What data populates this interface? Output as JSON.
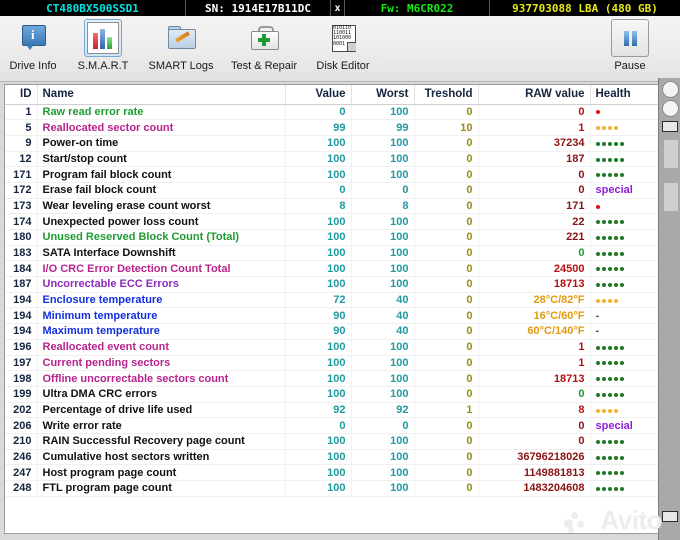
{
  "window": {
    "drive_model": "CT480BX500SSD1",
    "serial": "SN: 1914E17B11DC",
    "close_label": "x",
    "firmware": "Fw: M6CR022",
    "capacity": "937703088 LBA (480 GB)",
    "colors": {
      "model": "#00e5e5",
      "serial": "#ffffff",
      "firmware": "#14e814",
      "capacity": "#e8e814",
      "topbar_bg": "#000000"
    }
  },
  "toolbar": {
    "items": [
      {
        "label": "Drive Info",
        "icon": "info-bubble-icon",
        "selected": false
      },
      {
        "label": "S.M.A.R.T",
        "icon": "bar-chart-icon",
        "selected": true
      },
      {
        "label": "SMART Logs",
        "icon": "folder-pencil-icon",
        "selected": false
      },
      {
        "label": "Test & Repair",
        "icon": "first-aid-kit-icon",
        "selected": false
      },
      {
        "label": "Disk Editor",
        "icon": "hex-page-icon",
        "selected": false
      }
    ],
    "pause": {
      "label": "Pause",
      "icon": "pause-icon"
    },
    "hex_icon_text": [
      "010110",
      "110011",
      "101000",
      "0001"
    ]
  },
  "table": {
    "columns": [
      {
        "key": "id",
        "label": "ID"
      },
      {
        "key": "name",
        "label": "Name"
      },
      {
        "key": "value",
        "label": "Value"
      },
      {
        "key": "worst",
        "label": "Worst"
      },
      {
        "key": "thr",
        "label": "Treshold"
      },
      {
        "key": "raw",
        "label": "RAW value"
      },
      {
        "key": "health",
        "label": "Health"
      }
    ],
    "rows": [
      {
        "id": "1",
        "name": "Raw read error rate",
        "name_color": "green",
        "value": "0",
        "worst": "100",
        "thr": "0",
        "raw": "0",
        "raw_color": "red",
        "health": "dots",
        "dots": 1,
        "dot_color": "r"
      },
      {
        "id": "5",
        "name": "Reallocated sector count",
        "name_color": "magenta",
        "value": "99",
        "worst": "99",
        "thr": "10",
        "raw": "1",
        "raw_color": "red",
        "health": "dots",
        "dots": 4,
        "dot_color": "o"
      },
      {
        "id": "9",
        "name": "Power-on time",
        "name_color": "black",
        "value": "100",
        "worst": "100",
        "thr": "0",
        "raw": "37234",
        "raw_color": "dark",
        "health": "dots",
        "dots": 5,
        "dot_color": "g"
      },
      {
        "id": "12",
        "name": "Start/stop count",
        "name_color": "black",
        "value": "100",
        "worst": "100",
        "thr": "0",
        "raw": "187",
        "raw_color": "dark",
        "health": "dots",
        "dots": 5,
        "dot_color": "g"
      },
      {
        "id": "171",
        "name": "Program fail block count",
        "name_color": "black",
        "value": "100",
        "worst": "100",
        "thr": "0",
        "raw": "0",
        "raw_color": "dark",
        "health": "dots",
        "dots": 5,
        "dot_color": "g"
      },
      {
        "id": "172",
        "name": "Erase fail block count",
        "name_color": "black",
        "value": "0",
        "worst": "0",
        "thr": "0",
        "raw": "0",
        "raw_color": "dark",
        "health": "special"
      },
      {
        "id": "173",
        "name": "Wear leveling erase count worst",
        "name_color": "black",
        "value": "8",
        "worst": "8",
        "thr": "0",
        "raw": "171",
        "raw_color": "dark",
        "health": "dots",
        "dots": 1,
        "dot_color": "r"
      },
      {
        "id": "174",
        "name": "Unexpected power loss count",
        "name_color": "black",
        "value": "100",
        "worst": "100",
        "thr": "0",
        "raw": "22",
        "raw_color": "dark",
        "health": "dots",
        "dots": 5,
        "dot_color": "g"
      },
      {
        "id": "180",
        "name": "Unused Reserved Block Count (Total)",
        "name_color": "green",
        "value": "100",
        "worst": "100",
        "thr": "0",
        "raw": "221",
        "raw_color": "dark",
        "health": "dots",
        "dots": 5,
        "dot_color": "g"
      },
      {
        "id": "183",
        "name": "SATA Interface Downshift",
        "name_color": "black",
        "value": "100",
        "worst": "100",
        "thr": "0",
        "raw": "0",
        "raw_color": "green",
        "health": "dots",
        "dots": 5,
        "dot_color": "g"
      },
      {
        "id": "184",
        "name": "I/O CRC Error Detection Count Total",
        "name_color": "magenta",
        "value": "100",
        "worst": "100",
        "thr": "0",
        "raw": "24500",
        "raw_color": "red",
        "health": "dots",
        "dots": 5,
        "dot_color": "g"
      },
      {
        "id": "187",
        "name": "Uncorrectable ECC Errors",
        "name_color": "purple",
        "value": "100",
        "worst": "100",
        "thr": "0",
        "raw": "18713",
        "raw_color": "red",
        "health": "dots",
        "dots": 5,
        "dot_color": "g"
      },
      {
        "id": "194",
        "name": "Enclosure temperature",
        "name_color": "blue",
        "value": "72",
        "worst": "40",
        "thr": "0",
        "raw": "28°C/82°F",
        "raw_color": "orange",
        "health": "dots",
        "dots": 4,
        "dot_color": "o"
      },
      {
        "id": "194",
        "name": "Minimum temperature",
        "name_color": "blue",
        "value": "90",
        "worst": "40",
        "thr": "0",
        "raw": "16°C/60°F",
        "raw_color": "orange",
        "health": "dash"
      },
      {
        "id": "194",
        "name": "Maximum temperature",
        "name_color": "blue",
        "value": "90",
        "worst": "40",
        "thr": "0",
        "raw": "60°C/140°F",
        "raw_color": "orange",
        "health": "dash"
      },
      {
        "id": "196",
        "name": "Reallocated event count",
        "name_color": "magenta",
        "value": "100",
        "worst": "100",
        "thr": "0",
        "raw": "1",
        "raw_color": "red",
        "health": "dots",
        "dots": 5,
        "dot_color": "g"
      },
      {
        "id": "197",
        "name": "Current pending sectors",
        "name_color": "magenta",
        "value": "100",
        "worst": "100",
        "thr": "0",
        "raw": "1",
        "raw_color": "red",
        "health": "dots",
        "dots": 5,
        "dot_color": "g"
      },
      {
        "id": "198",
        "name": "Offline uncorrectable sectors count",
        "name_color": "magenta",
        "value": "100",
        "worst": "100",
        "thr": "0",
        "raw": "18713",
        "raw_color": "red",
        "health": "dots",
        "dots": 5,
        "dot_color": "g"
      },
      {
        "id": "199",
        "name": "Ultra DMA CRC errors",
        "name_color": "black",
        "value": "100",
        "worst": "100",
        "thr": "0",
        "raw": "0",
        "raw_color": "green",
        "health": "dots",
        "dots": 5,
        "dot_color": "g"
      },
      {
        "id": "202",
        "name": "Percentage of drive life used",
        "name_color": "black",
        "value": "92",
        "worst": "92",
        "thr": "1",
        "raw": "8",
        "raw_color": "red",
        "health": "dots",
        "dots": 4,
        "dot_color": "o"
      },
      {
        "id": "206",
        "name": "Write error rate",
        "name_color": "black",
        "value": "0",
        "worst": "0",
        "thr": "0",
        "raw": "0",
        "raw_color": "dark",
        "health": "special"
      },
      {
        "id": "210",
        "name": "RAIN Successful Recovery page count",
        "name_color": "black",
        "value": "100",
        "worst": "100",
        "thr": "0",
        "raw": "0",
        "raw_color": "dark",
        "health": "dots",
        "dots": 5,
        "dot_color": "g"
      },
      {
        "id": "246",
        "name": "Cumulative host sectors written",
        "name_color": "black",
        "value": "100",
        "worst": "100",
        "thr": "0",
        "raw": "36796218026",
        "raw_color": "dark",
        "health": "dots",
        "dots": 5,
        "dot_color": "g"
      },
      {
        "id": "247",
        "name": "Host program page count",
        "name_color": "black",
        "value": "100",
        "worst": "100",
        "thr": "0",
        "raw": "1149881813",
        "raw_color": "dark",
        "health": "dots",
        "dots": 5,
        "dot_color": "g"
      },
      {
        "id": "248",
        "name": "FTL program page count",
        "name_color": "black",
        "value": "100",
        "worst": "100",
        "thr": "0",
        "raw": "1483204608",
        "raw_color": "dark",
        "health": "dots",
        "dots": 5,
        "dot_color": "g"
      }
    ],
    "special_label": "special",
    "dash_label": "-"
  },
  "watermark": {
    "text": "Avito"
  }
}
